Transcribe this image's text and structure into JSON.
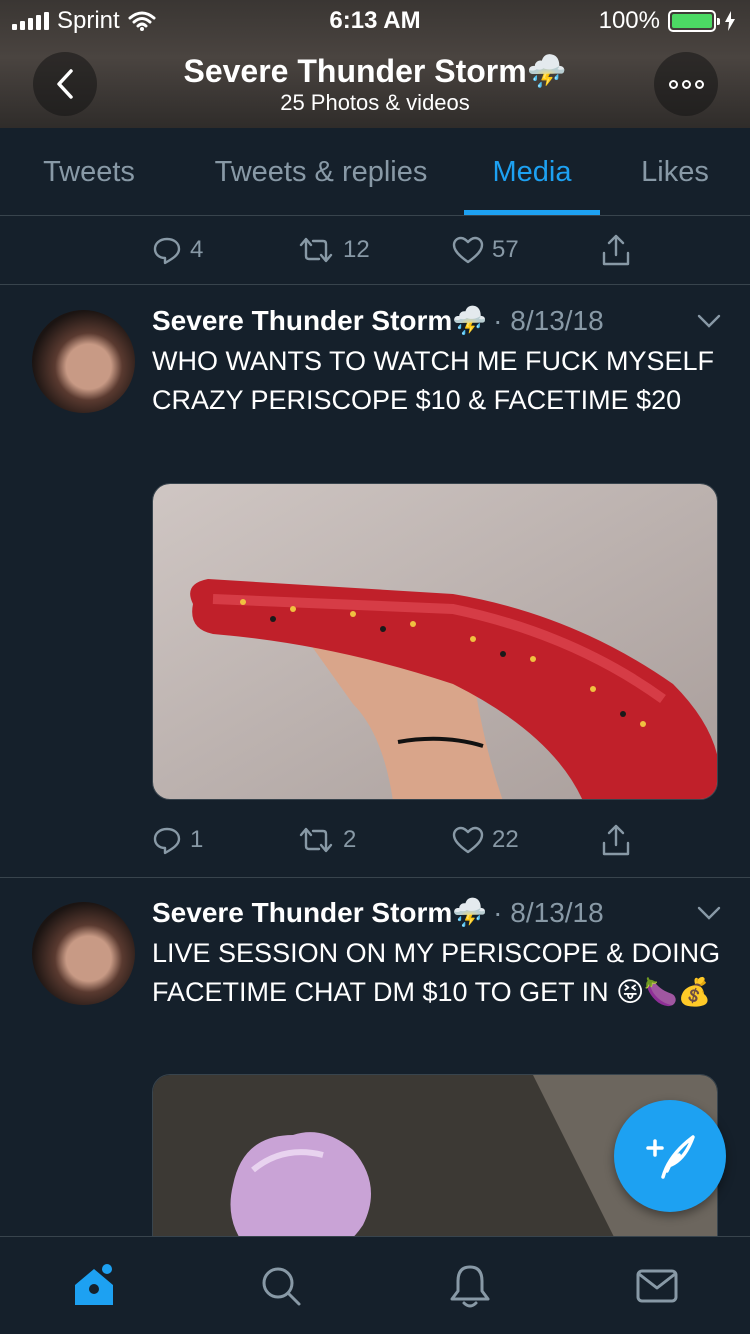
{
  "status_bar": {
    "carrier": "Sprint",
    "time": "6:13 AM",
    "battery_percent": "100%",
    "battery_level": 1.0,
    "battery_color": "#4cd964"
  },
  "header": {
    "title": "Severe Thunder Storm⛈️",
    "subtitle": "25 Photos & videos",
    "back_icon": "chevron-left-icon",
    "more_icon": "more-horizontal-icon"
  },
  "tabs": [
    {
      "label": "Tweets",
      "active": false
    },
    {
      "label": "Tweets & replies",
      "active": false
    },
    {
      "label": "Media",
      "active": true
    },
    {
      "label": "Likes",
      "active": false
    }
  ],
  "accent_color": "#1da1f2",
  "top_actions": {
    "replies": "4",
    "retweets": "12",
    "likes": "57"
  },
  "tweets": [
    {
      "author": "Severe Thunder Storm⛈️",
      "date": "· 8/13/18",
      "text": "WHO WANTS TO WATCH ME FUCK MYSELF CRAZY PERISCOPE $10 & FACETIME $20",
      "replies": "1",
      "retweets": "2",
      "likes": "22"
    },
    {
      "author": "Severe Thunder Storm⛈️",
      "date": "· 8/13/18",
      "text": "LIVE SESSION ON MY PERISCOPE & DOING FACETIME CHAT DM $10 TO GET IN 😝🍆💰"
    }
  ],
  "fab": {
    "icon": "compose-tweet-icon"
  },
  "bottom_nav": [
    {
      "icon": "home-icon",
      "active": true
    },
    {
      "icon": "search-icon",
      "active": false
    },
    {
      "icon": "notifications-bell-icon",
      "active": false
    },
    {
      "icon": "messages-envelope-icon",
      "active": false
    }
  ]
}
